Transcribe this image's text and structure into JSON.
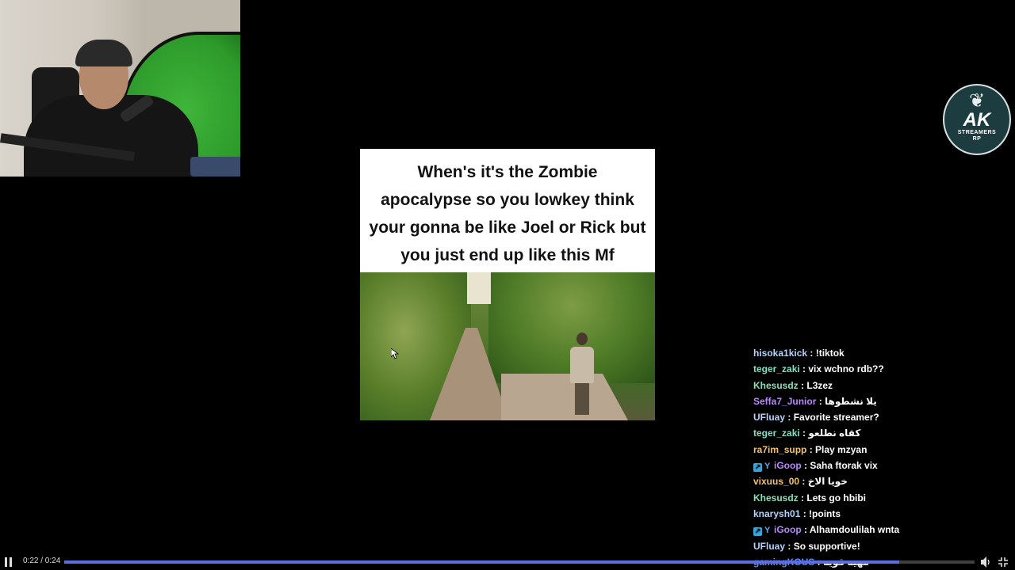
{
  "logo": {
    "main": "AK",
    "sub_line1": "STREAMERS",
    "sub_line2": "RP"
  },
  "meme": {
    "caption": "When's it's the Zombie\napocalypse so you lowkey think\nyour gonna be like Joel or Rick but\nyou just end up like this Mf"
  },
  "chat": [
    {
      "user": "hisoka1kick",
      "color": "#b3d3ff",
      "message": "!tiktok",
      "badge": false
    },
    {
      "user": "teger_zaki",
      "color": "#7fe0c2",
      "message": "vix wchno rdb??",
      "badge": false
    },
    {
      "user": "Khesusdz",
      "color": "#86e0b6",
      "message": "L3zez",
      "badge": false
    },
    {
      "user": "Seffa7_Junior",
      "color": "#b987ff",
      "message": "يلا نشطوها",
      "badge": false
    },
    {
      "user": "UFluay",
      "color": "#b3d3ff",
      "message": "Favorite streamer?",
      "badge": false
    },
    {
      "user": "teger_zaki",
      "color": "#7fe0c2",
      "message": "كقاه نطلعو",
      "badge": false
    },
    {
      "user": "ra7im_supp",
      "color": "#f2c26b",
      "message": "Play mzyan",
      "badge": false
    },
    {
      "user": "iGoop",
      "color": "#b987ff",
      "message": "Saha ftorak vix",
      "badge": true
    },
    {
      "user": "vixuus_00",
      "color": "#f2c26b",
      "message": "خويا الاخ",
      "badge": false
    },
    {
      "user": "Khesusdz",
      "color": "#86e0b6",
      "message": "Lets go hbibi",
      "badge": false
    },
    {
      "user": "knarysh01",
      "color": "#b3d3ff",
      "message": "!points",
      "badge": false
    },
    {
      "user": "iGoop",
      "color": "#b987ff",
      "message": "Alhamdoulilah wnta",
      "badge": true
    },
    {
      "user": "UFluay",
      "color": "#b3d3ff",
      "message": "So supportive!",
      "badge": false
    },
    {
      "user": "gamingKOUS",
      "color": "#5b8cff",
      "message": "مهيه قوية",
      "badge": false
    }
  ],
  "player": {
    "time": "0:22 / 0:24",
    "progress_fraction": 0.917,
    "accent": "#5b6ee1"
  }
}
